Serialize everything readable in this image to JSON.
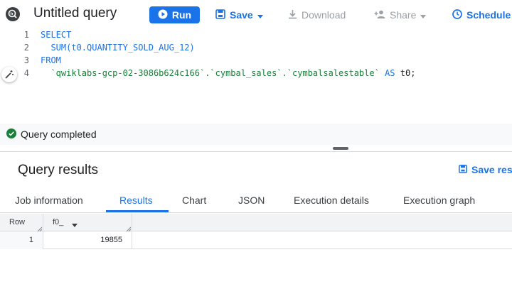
{
  "toolbar": {
    "title": "Untitled query",
    "run_label": "Run",
    "save_label": "Save",
    "download_label": "Download",
    "share_label": "Share",
    "schedule_label": "Schedule"
  },
  "editor": {
    "line_numbers": [
      "1",
      "2",
      "3",
      "4"
    ],
    "line1": "SELECT",
    "line2": "  SUM(t0.QUANTITY_SOLD_AUG_12)",
    "line3": "FROM",
    "line4_table": "  `qwiklabs-gcp-02-3086b624c166`.`cymbal_sales`.`cymbalsalestable`",
    "line4_as": "AS",
    "line4_alias": "t0;"
  },
  "status": {
    "text": "Query completed"
  },
  "results": {
    "title": "Query results",
    "save_label": "Save res",
    "tabs": [
      "Job information",
      "Results",
      "Chart",
      "JSON",
      "Execution details",
      "Execution graph"
    ],
    "active_tab": "Results",
    "columns": [
      "Row",
      "f0_"
    ],
    "rows": [
      {
        "row": "1",
        "f0_": "19855"
      }
    ]
  },
  "colors": {
    "accent": "#1a73e8",
    "success": "#188038",
    "disabled": "#9aa0a6"
  }
}
